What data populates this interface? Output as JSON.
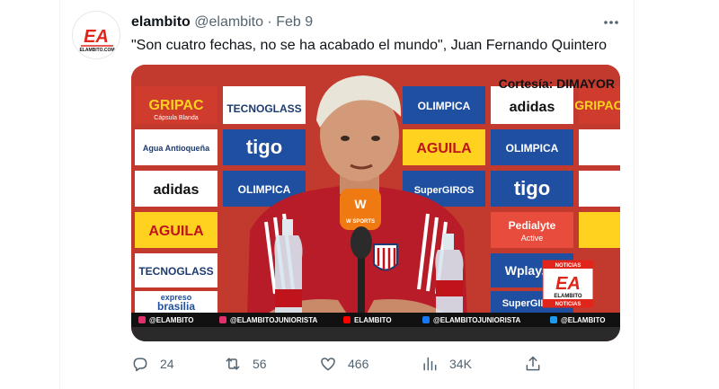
{
  "tweet": {
    "author": {
      "display_name": "elambito",
      "handle": "@elambito",
      "avatar_text": "EA",
      "avatar_subtext": "ELAMBITO.COM"
    },
    "separator": "·",
    "date": "Feb 9",
    "text": "\"Son cuatro fechas, no se ha acabado el mundo\", Juan Fernando Quintero",
    "media": {
      "credit": "Cortesía: DIMAYOR",
      "sponsors": {
        "gripac": "GRIPAC",
        "gripac_sub": "Cápsula Blanda",
        "tecnoglass": "TECNOGLASS",
        "aguila": "AGUILA",
        "olimpica": "OLIMPICA",
        "adidas": "adidas",
        "tigo": "tigo",
        "supergiros": "SuperGIROS",
        "pedialyte": "Pedialyte",
        "pedialyte_sub": "Active",
        "wplay": "Wplay.co",
        "expreso": "expreso",
        "brasilia": "brasilia",
        "agua_antioquena": "Agua Antioqueña"
      },
      "mic_label": "W",
      "mic_sub": "W SPORTS",
      "logo_badge": {
        "top": "NOTICIAS",
        "letters": "EA",
        "mid": "ELAMBITO",
        "bottom": "NOTICIAS"
      },
      "social_bar": [
        "@ELAMBITO",
        "@ELAMBITOJUNIORISTA",
        "ELAMBITO",
        "@ELAMBITOJUNIORISTA",
        "@ELAMBITO"
      ]
    },
    "stats": {
      "replies": "24",
      "retweets": "56",
      "likes": "466",
      "views": "34K"
    }
  },
  "colors": {
    "text": "#0f1419",
    "muted": "#536471",
    "backdrop_red": "#c0392b",
    "social_bar": "#111111",
    "brand_red": "#e0251b"
  }
}
